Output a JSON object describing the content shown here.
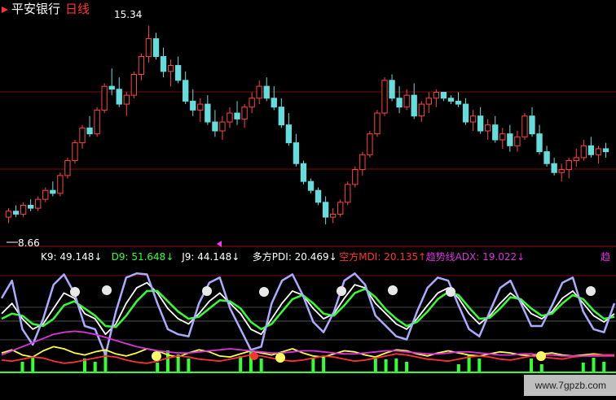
{
  "chart_data": [
    {
      "type": "candlestick",
      "title": "平安银行",
      "period": "日线",
      "high_label": "15.34",
      "low_label": "8.66",
      "ylim": [
        8.0,
        15.6
      ],
      "candles": [
        [
          8.9,
          9.2,
          8.7,
          9.1
        ],
        [
          9.1,
          9.3,
          8.9,
          9.0
        ],
        [
          9.0,
          9.4,
          8.9,
          9.3
        ],
        [
          9.3,
          9.5,
          9.1,
          9.2
        ],
        [
          9.2,
          9.6,
          9.1,
          9.5
        ],
        [
          9.5,
          9.9,
          9.4,
          9.8
        ],
        [
          9.8,
          10.1,
          9.6,
          9.7
        ],
        [
          9.7,
          10.4,
          9.6,
          10.3
        ],
        [
          10.3,
          10.9,
          10.2,
          10.8
        ],
        [
          10.8,
          11.5,
          10.7,
          11.4
        ],
        [
          11.4,
          12.0,
          11.2,
          11.9
        ],
        [
          11.9,
          12.3,
          11.6,
          11.7
        ],
        [
          11.7,
          12.6,
          11.6,
          12.5
        ],
        [
          12.5,
          13.4,
          12.4,
          13.3
        ],
        [
          13.3,
          13.9,
          13.0,
          13.2
        ],
        [
          13.2,
          13.6,
          12.6,
          12.7
        ],
        [
          12.7,
          13.1,
          12.3,
          13.0
        ],
        [
          13.0,
          13.8,
          12.9,
          13.7
        ],
        [
          13.7,
          14.4,
          13.5,
          14.3
        ],
        [
          14.3,
          15.34,
          14.1,
          14.9
        ],
        [
          14.9,
          15.1,
          14.2,
          14.3
        ],
        [
          14.3,
          14.6,
          13.6,
          13.8
        ],
        [
          13.8,
          14.2,
          13.3,
          14.0
        ],
        [
          14.0,
          14.3,
          13.4,
          13.5
        ],
        [
          13.5,
          13.8,
          12.7,
          12.8
        ],
        [
          12.8,
          13.2,
          12.3,
          12.5
        ],
        [
          12.5,
          12.9,
          12.1,
          12.7
        ],
        [
          12.7,
          13.0,
          12.0,
          12.1
        ],
        [
          12.1,
          12.5,
          11.6,
          11.8
        ],
        [
          11.8,
          12.3,
          11.5,
          12.1
        ],
        [
          12.1,
          12.6,
          11.9,
          12.4
        ],
        [
          12.4,
          12.8,
          12.0,
          12.2
        ],
        [
          12.2,
          12.7,
          11.9,
          12.6
        ],
        [
          12.6,
          13.1,
          12.4,
          12.9
        ],
        [
          12.9,
          13.5,
          12.7,
          13.3
        ],
        [
          13.3,
          13.6,
          12.8,
          12.9
        ],
        [
          12.9,
          13.3,
          12.5,
          12.6
        ],
        [
          12.6,
          12.9,
          11.9,
          12.0
        ],
        [
          12.0,
          12.4,
          11.3,
          11.4
        ],
        [
          11.4,
          11.7,
          10.6,
          10.7
        ],
        [
          10.7,
          10.8,
          10.0,
          10.1
        ],
        [
          10.1,
          10.2,
          9.7,
          9.8
        ],
        [
          9.8,
          9.9,
          9.3,
          9.4
        ],
        [
          9.4,
          9.6,
          8.66,
          8.9
        ],
        [
          8.9,
          9.2,
          8.7,
          9.0
        ],
        [
          9.0,
          9.5,
          8.9,
          9.4
        ],
        [
          9.4,
          10.1,
          9.3,
          10.0
        ],
        [
          10.0,
          10.6,
          9.9,
          10.5
        ],
        [
          10.5,
          11.1,
          10.3,
          11.0
        ],
        [
          11.0,
          11.8,
          10.9,
          11.7
        ],
        [
          11.7,
          12.5,
          11.6,
          12.4
        ],
        [
          12.4,
          13.6,
          12.3,
          13.5
        ],
        [
          13.5,
          13.7,
          12.8,
          12.9
        ],
        [
          12.9,
          13.3,
          12.4,
          12.6
        ],
        [
          12.6,
          13.2,
          12.5,
          13.0
        ],
        [
          13.0,
          13.4,
          12.2,
          12.3
        ],
        [
          12.3,
          12.8,
          12.1,
          12.7
        ],
        [
          12.7,
          13.1,
          12.4,
          12.9
        ],
        [
          12.9,
          13.2,
          12.6,
          13.1
        ],
        [
          13.1,
          13.1,
          12.8,
          12.9
        ],
        [
          12.9,
          13.0,
          12.7,
          12.8
        ],
        [
          12.8,
          13.1,
          12.6,
          12.7
        ],
        [
          12.7,
          12.9,
          12.0,
          12.1
        ],
        [
          12.1,
          12.5,
          11.8,
          12.3
        ],
        [
          12.3,
          12.6,
          11.7,
          11.8
        ],
        [
          11.8,
          12.2,
          11.5,
          12.0
        ],
        [
          12.0,
          12.3,
          11.4,
          11.5
        ],
        [
          11.5,
          11.9,
          11.2,
          11.7
        ],
        [
          11.7,
          12.0,
          11.1,
          11.3
        ],
        [
          11.3,
          11.8,
          11.1,
          11.6
        ],
        [
          11.6,
          12.4,
          11.5,
          12.3
        ],
        [
          12.3,
          12.6,
          11.6,
          11.7
        ],
        [
          11.7,
          12.0,
          11.0,
          11.1
        ],
        [
          11.1,
          11.3,
          10.6,
          10.7
        ],
        [
          10.7,
          10.9,
          10.3,
          10.4
        ],
        [
          10.4,
          10.7,
          10.1,
          10.5
        ],
        [
          10.5,
          10.9,
          10.2,
          10.8
        ],
        [
          10.8,
          11.2,
          10.6,
          10.9
        ],
        [
          10.9,
          11.5,
          10.8,
          11.3
        ],
        [
          11.3,
          11.6,
          10.9,
          11.0
        ],
        [
          11.0,
          11.3,
          10.7,
          11.2
        ],
        [
          11.2,
          11.4,
          10.9,
          11.1
        ]
      ]
    },
    {
      "type": "line",
      "indicators": [
        {
          "name": "K9",
          "value": "49.148",
          "color": "#ffffff"
        },
        {
          "name": "D9",
          "value": "51.648",
          "color": "#33ff33"
        },
        {
          "name": "J9",
          "value": "44.148",
          "color": "#ffffff"
        },
        {
          "name": "多方PDI",
          "value": "20.469",
          "color": "#ffffff"
        },
        {
          "name": "空方MDI",
          "value": "20.135",
          "color": "#ff3333",
          "arrow": "↑"
        },
        {
          "name": "趋势线ADX",
          "value": "19.022",
          "color": "#dd33dd"
        }
      ],
      "overflow_label": "趋",
      "ylim": [
        0,
        100
      ],
      "series": [
        {
          "name": "K9",
          "color": "#ffffff",
          "values": [
            60,
            70,
            55,
            45,
            50,
            65,
            80,
            75,
            60,
            55,
            40,
            50,
            70,
            85,
            90,
            80,
            65,
            55,
            50,
            60,
            72,
            80,
            70,
            60,
            45,
            40,
            55,
            70,
            82,
            78,
            65,
            55,
            60,
            75,
            88,
            85,
            70,
            60,
            50,
            45,
            55,
            68,
            80,
            85,
            75,
            60,
            50,
            58,
            70,
            80,
            72,
            60,
            55,
            62,
            75,
            82,
            70,
            58,
            52,
            60
          ]
        },
        {
          "name": "D9",
          "color": "#33ff33",
          "values": [
            55,
            60,
            58,
            50,
            48,
            55,
            68,
            72,
            65,
            58,
            48,
            47,
            58,
            72,
            82,
            82,
            72,
            62,
            55,
            57,
            65,
            73,
            72,
            65,
            52,
            45,
            50,
            62,
            74,
            78,
            70,
            60,
            58,
            68,
            80,
            84,
            76,
            64,
            55,
            48,
            52,
            62,
            74,
            81,
            78,
            66,
            55,
            56,
            65,
            76,
            74,
            65,
            58,
            60,
            70,
            78,
            74,
            63,
            55,
            57
          ]
        },
        {
          "name": "J9",
          "color": "#aaaaff",
          "values": [
            75,
            92,
            45,
            30,
            55,
            88,
            98,
            80,
            48,
            45,
            20,
            62,
            95,
            99,
            98,
            70,
            45,
            40,
            38,
            70,
            90,
            95,
            65,
            45,
            25,
            28,
            70,
            92,
            98,
            78,
            52,
            42,
            62,
            92,
            99,
            88,
            58,
            48,
            38,
            35,
            62,
            85,
            95,
            92,
            68,
            45,
            38,
            62,
            85,
            92,
            70,
            48,
            48,
            68,
            90,
            95,
            62,
            45,
            42,
            70
          ]
        },
        {
          "name": "多方PDI",
          "color": "#ffff44",
          "values": [
            22,
            25,
            20,
            18,
            24,
            28,
            26,
            22,
            20,
            23,
            25,
            21,
            19,
            22,
            26,
            24,
            20,
            18,
            22,
            25,
            23,
            19,
            18,
            21,
            24,
            22,
            20,
            23,
            26,
            22,
            19,
            18,
            21,
            24,
            23,
            20,
            18,
            22,
            25,
            24,
            21,
            19,
            22,
            24,
            22,
            20,
            19,
            21,
            23,
            22,
            20,
            19,
            21,
            22,
            20,
            19,
            20,
            21,
            20,
            20
          ]
        },
        {
          "name": "空方MDI",
          "color": "#ff3333",
          "values": [
            15,
            14,
            16,
            18,
            17,
            14,
            12,
            13,
            15,
            17,
            19,
            18,
            15,
            13,
            12,
            14,
            17,
            19,
            18,
            16,
            15,
            14,
            16,
            18,
            20,
            19,
            17,
            15,
            14,
            15,
            17,
            19,
            18,
            16,
            14,
            15,
            17,
            19,
            21,
            20,
            18,
            16,
            15,
            14,
            16,
            18,
            19,
            18,
            16,
            15,
            17,
            19,
            18,
            17,
            16,
            18,
            19,
            20,
            20,
            20
          ]
        },
        {
          "name": "趋势线ADX",
          "color": "#dd33dd",
          "values": [
            20,
            24,
            28,
            32,
            36,
            40,
            42,
            43,
            42,
            40,
            37,
            34,
            31,
            28,
            26,
            24,
            23,
            22,
            22,
            23,
            24,
            25,
            26,
            25,
            24,
            23,
            22,
            22,
            23,
            24,
            24,
            23,
            22,
            21,
            21,
            22,
            23,
            24,
            24,
            23,
            22,
            21,
            21,
            22,
            23,
            23,
            22,
            21,
            20,
            20,
            21,
            21,
            20,
            20,
            19,
            19,
            19,
            19,
            19,
            19
          ]
        }
      ]
    }
  ],
  "watermark": "www.7gpzb.com"
}
